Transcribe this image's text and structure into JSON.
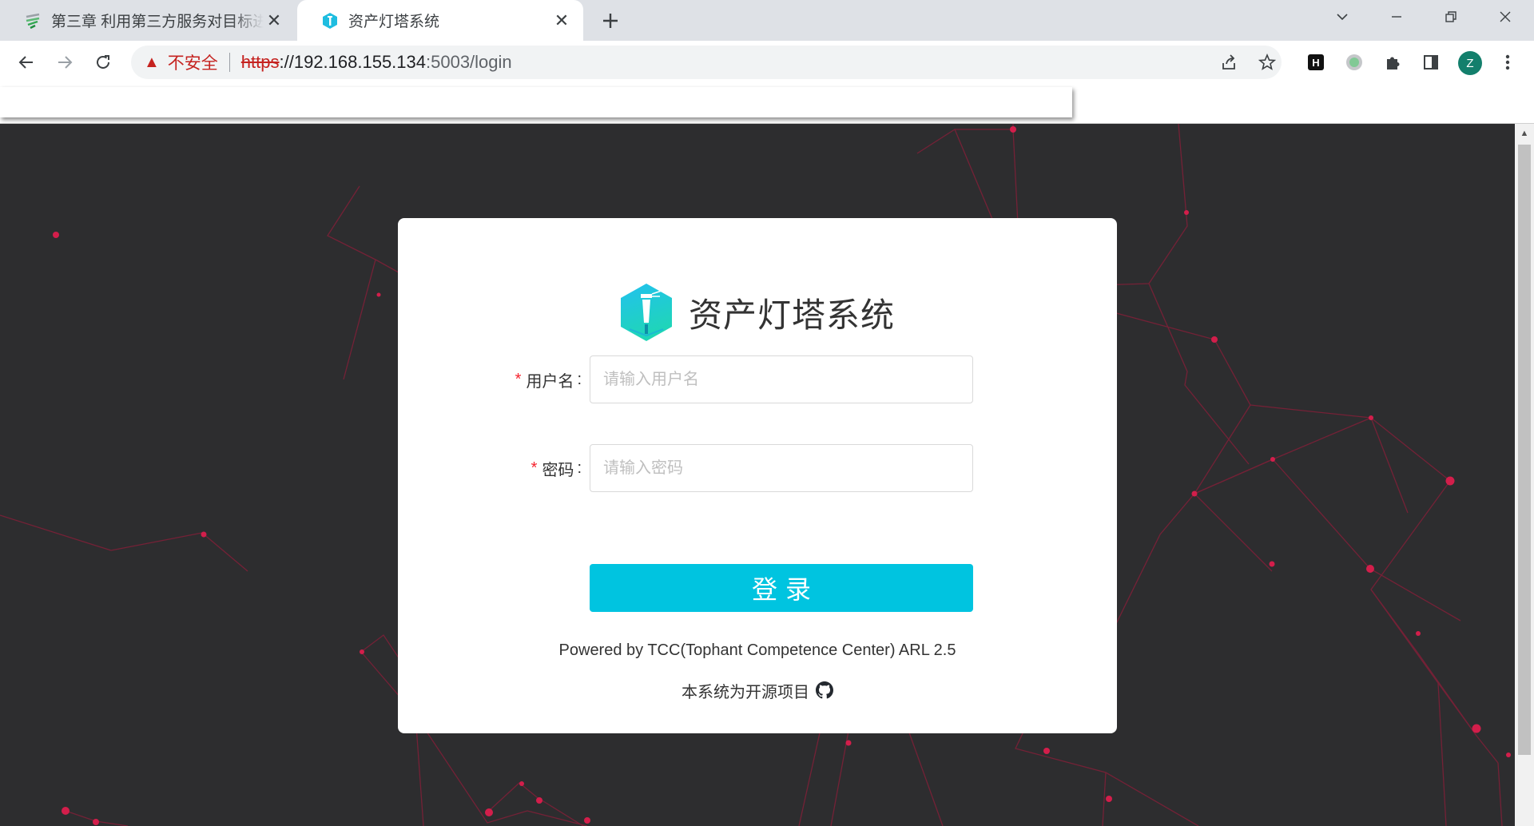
{
  "browser": {
    "tabs": [
      {
        "title": "第三章 利用第三方服务对目标进行被动信息收集",
        "active": false,
        "favicon": "stacked-lines-icon"
      },
      {
        "title": "资产灯塔系统",
        "active": true,
        "favicon": "lighthouse-icon"
      }
    ],
    "address": {
      "security_label": "不安全",
      "scheme": "https",
      "host": "://192.168.155.134",
      "rest": ":5003/login"
    },
    "profile_initial": "Z",
    "extension_h_label": "H"
  },
  "login": {
    "brand_name": "资产灯塔系统",
    "username_label": "用户名",
    "username_placeholder": "请输入用户名",
    "password_label": "密码",
    "password_placeholder": "请输入密码",
    "required_mark": "*",
    "colon": ":",
    "submit_label": "登录",
    "powered_by": "Powered by TCC(Tophant Competence Center) ARL 2.5",
    "open_source_note": "本系统为开源项目"
  },
  "colors": {
    "accent": "#00c4e0",
    "background": "#2d2d2f",
    "network_line": "#a0203e",
    "network_dot": "#d31e4b",
    "profile": "#137f6c"
  }
}
